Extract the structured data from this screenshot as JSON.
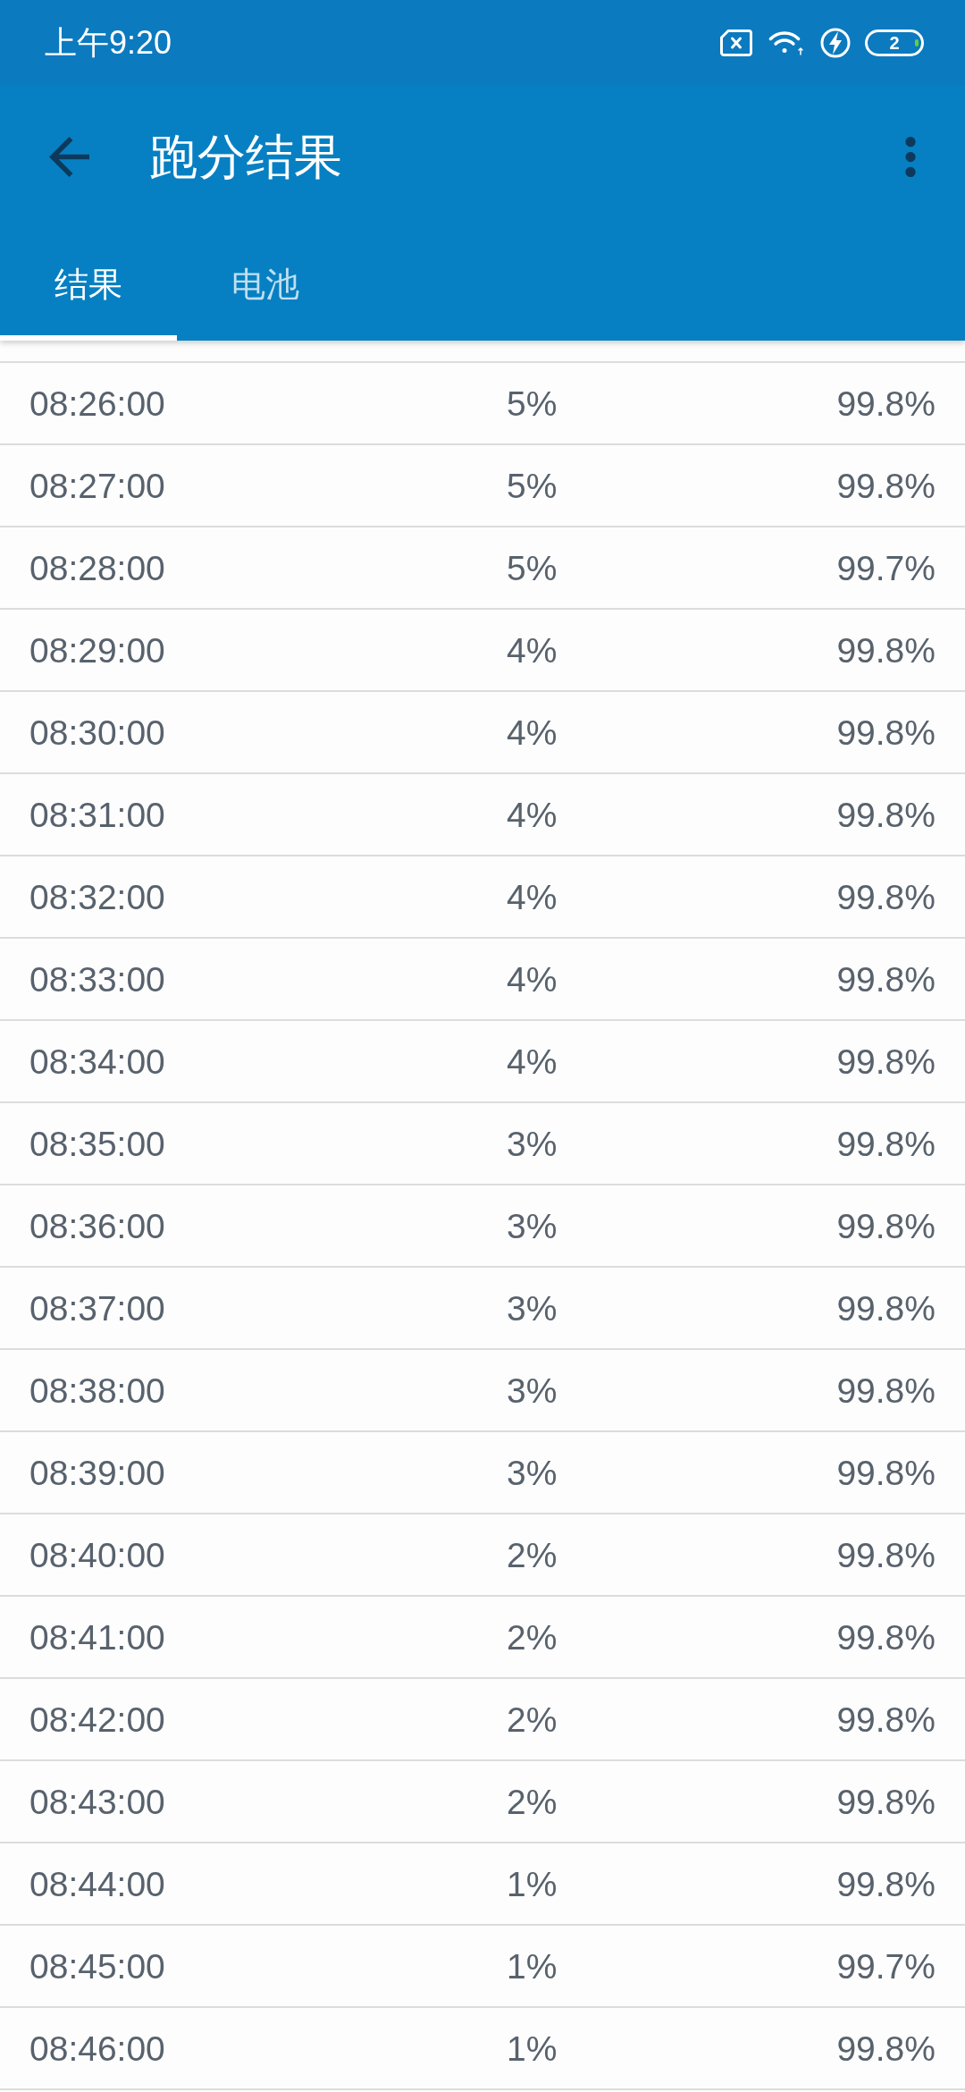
{
  "status_bar": {
    "time": "上午9:20",
    "battery": "2"
  },
  "app_bar": {
    "title": "跑分结果"
  },
  "tabs": [
    {
      "label": "结果",
      "selected": true
    },
    {
      "label": "电池",
      "selected": false
    }
  ],
  "table": {
    "rows": [
      [
        "08:26:00",
        "5%",
        "99.8%"
      ],
      [
        "08:27:00",
        "5%",
        "99.8%"
      ],
      [
        "08:28:00",
        "5%",
        "99.7%"
      ],
      [
        "08:29:00",
        "4%",
        "99.8%"
      ],
      [
        "08:30:00",
        "4%",
        "99.8%"
      ],
      [
        "08:31:00",
        "4%",
        "99.8%"
      ],
      [
        "08:32:00",
        "4%",
        "99.8%"
      ],
      [
        "08:33:00",
        "4%",
        "99.8%"
      ],
      [
        "08:34:00",
        "4%",
        "99.8%"
      ],
      [
        "08:35:00",
        "3%",
        "99.8%"
      ],
      [
        "08:36:00",
        "3%",
        "99.8%"
      ],
      [
        "08:37:00",
        "3%",
        "99.8%"
      ],
      [
        "08:38:00",
        "3%",
        "99.8%"
      ],
      [
        "08:39:00",
        "3%",
        "99.8%"
      ],
      [
        "08:40:00",
        "2%",
        "99.8%"
      ],
      [
        "08:41:00",
        "2%",
        "99.8%"
      ],
      [
        "08:42:00",
        "2%",
        "99.8%"
      ],
      [
        "08:43:00",
        "2%",
        "99.8%"
      ],
      [
        "08:44:00",
        "1%",
        "99.8%"
      ],
      [
        "08:45:00",
        "1%",
        "99.7%"
      ],
      [
        "08:46:00",
        "1%",
        "99.8%"
      ]
    ]
  }
}
